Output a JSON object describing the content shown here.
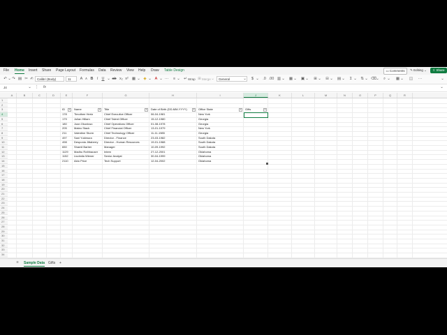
{
  "menu": {
    "items": [
      "File",
      "Home",
      "Insert",
      "Share",
      "Page Layout",
      "Formulas",
      "Data",
      "Review",
      "View",
      "Help",
      "Draw",
      "Table Design"
    ],
    "comments": "Comments",
    "editing": "Editing",
    "share": "Share"
  },
  "ribbon": {
    "font": "Calibri (Body)",
    "size": "11",
    "wrap": "Wrap",
    "merge": "Merge",
    "number_format": "General"
  },
  "formula_bar": {
    "name_box": "J4",
    "fx": "fx",
    "value": ""
  },
  "columns": [
    "A",
    "B",
    "C",
    "D",
    "E",
    "F",
    "G",
    "H",
    "I",
    "J",
    "K",
    "L",
    "M",
    "N",
    "O",
    "P",
    "Q",
    "R"
  ],
  "selected_column": "J",
  "selected_row": "4",
  "rows": [
    "1",
    "2",
    "3",
    "4",
    "5",
    "6",
    "7",
    "8",
    "9",
    "10",
    "11",
    "12",
    "13",
    "14",
    "15",
    "16",
    "17",
    "18",
    "19",
    "20",
    "21",
    "22",
    "23",
    "24",
    "25",
    "26",
    "27",
    "28",
    "29",
    "30",
    "31",
    "32",
    "33",
    "34",
    "35"
  ],
  "table": {
    "headers": [
      "ID",
      "Name",
      "Title",
      "Date of Birth (DD-MM-YYYY)",
      "Office State",
      "Gifts"
    ],
    "rows": [
      [
        "178",
        "Timothee Hertz",
        "Chief Executive Officer",
        "06-04-1981",
        "New York",
        ""
      ],
      [
        "179",
        "Julian Hillam",
        "Chief Talent Officer",
        "15-12-1980",
        "Georgia",
        ""
      ],
      [
        "180",
        "Joan Okonkwo",
        "Chief Operations Officer",
        "01-08-1978",
        "Georgia",
        ""
      ],
      [
        "205",
        "Mateo Stack",
        "Chief Financial Officer",
        "13-01-1979",
        "New York",
        ""
      ],
      [
        "211",
        "Valentine Sturm",
        "Chief Technology Officer",
        "11-11-1985",
        "Georgia",
        ""
      ],
      [
        "497",
        "Sani Yukimura",
        "Director - Finance",
        "23-03-1982",
        "South Dakota",
        ""
      ],
      [
        "498",
        "Desponia Jittaberry",
        "Director - Human Resources",
        "19-01-1988",
        "South Dakota",
        ""
      ],
      [
        "650",
        "Shamil Barber",
        "Manager",
        "10-09-1992",
        "South Dakota",
        ""
      ],
      [
        "1129",
        "Madhu Rothhauser",
        "Intern",
        "27-12-2001",
        "Oklahoma",
        ""
      ],
      [
        "1152",
        "Liudmila Wiener",
        "Senior Analyst",
        "30-04-1999",
        "Oklahoma",
        ""
      ],
      [
        "2110",
        "Aldo Price",
        "Tech Support",
        "12-04-2002",
        "Oklahoma",
        ""
      ]
    ]
  },
  "sheets": {
    "tabs": [
      "Sample Data",
      "Gifts"
    ],
    "active": "Sample Data",
    "add": "+"
  },
  "colors": {
    "accent": "#107c41"
  }
}
